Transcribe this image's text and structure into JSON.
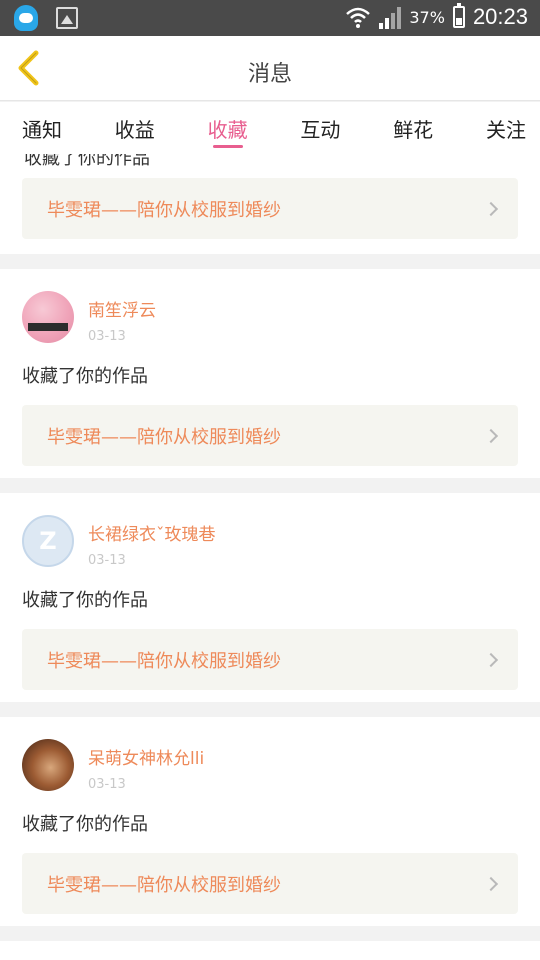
{
  "status_bar": {
    "battery_percent": "37%",
    "time": "20:23",
    "icons": [
      "qq-icon",
      "gallery-icon",
      "wifi-icon",
      "signal-icon",
      "battery-icon"
    ]
  },
  "header": {
    "title": "消息",
    "back_icon": "chevron-left-icon",
    "accent_color": "#f0c419"
  },
  "tabs": [
    {
      "label": "通知",
      "active": false
    },
    {
      "label": "收益",
      "active": false
    },
    {
      "label": "收藏",
      "active": true
    },
    {
      "label": "互动",
      "active": false
    },
    {
      "label": "鲜花",
      "active": false
    },
    {
      "label": "关注",
      "active": false
    }
  ],
  "colors": {
    "active_tab": "#e85e8f",
    "name": "#ee8a5a",
    "link_bg": "#f5f5f0"
  },
  "messages": [
    {
      "partial_text": "收藏了你的作品",
      "work_title": "毕雯珺——陪你从校服到婚纱"
    },
    {
      "user_name": "南笙浮云",
      "date": "03-13",
      "action": "收藏了你的作品",
      "work_title": "毕雯珺——陪你从校服到婚纱"
    },
    {
      "user_name": "长裙绿衣ˇ玫瑰巷",
      "date": "03-13",
      "action": "收藏了你的作品",
      "work_title": "毕雯珺——陪你从校服到婚纱"
    },
    {
      "user_name": "呆萌女神林允lli",
      "date": "03-13",
      "action": "收藏了你的作品",
      "work_title": "毕雯珺——陪你从校服到婚纱"
    }
  ]
}
